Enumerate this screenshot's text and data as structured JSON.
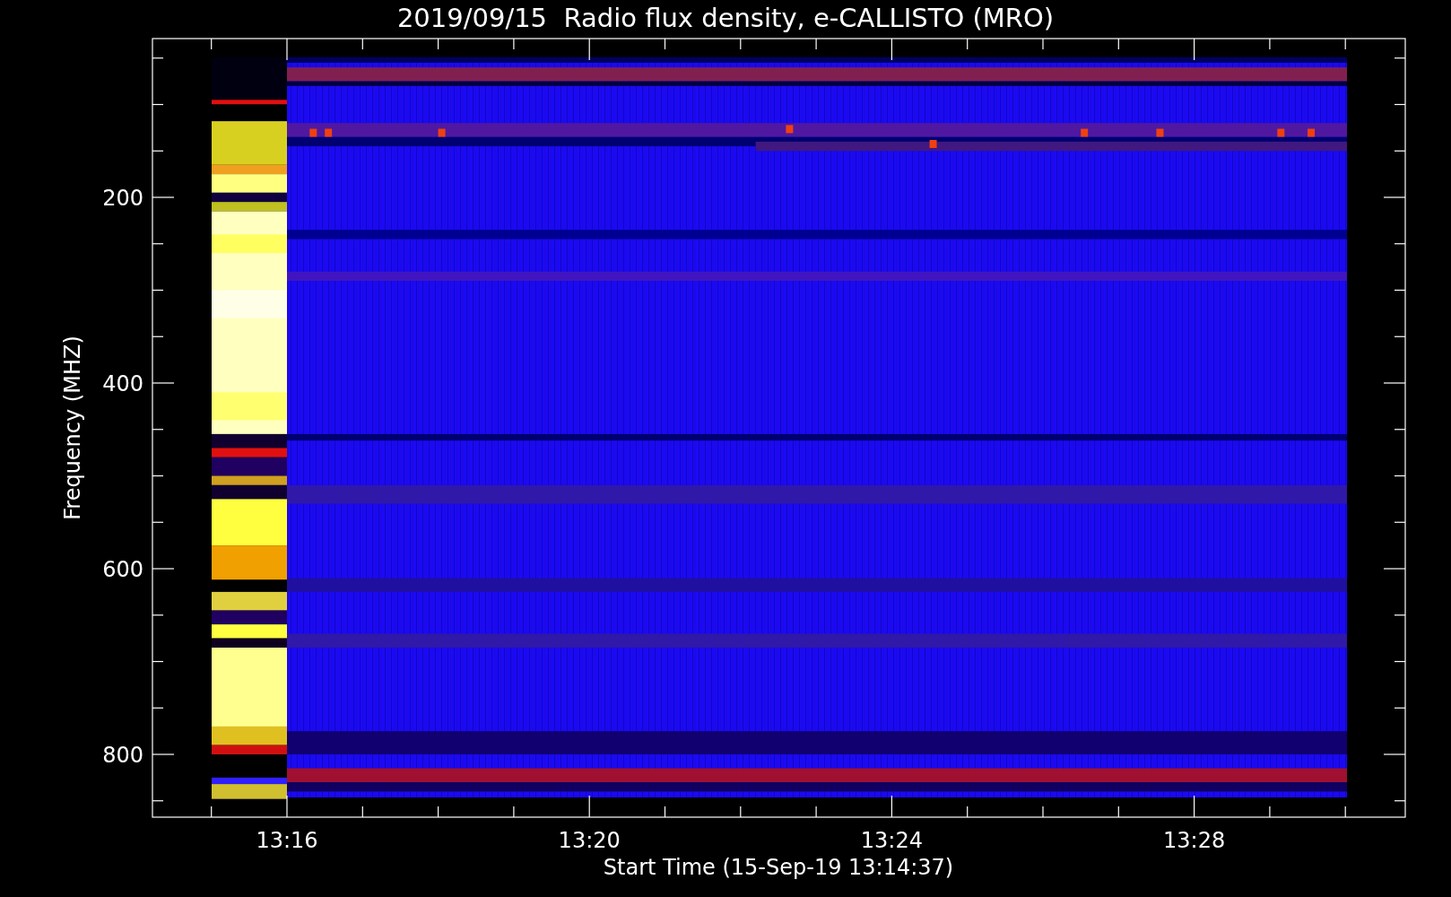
{
  "title": "2019/09/15  Radio flux density, e-CALLISTO (MRO)",
  "y_axis": {
    "label": "Frequency (MHZ)",
    "ticks": [
      "200",
      "400",
      "600",
      "800"
    ]
  },
  "x_axis": {
    "label": "Start Time (15-Sep-19 13:14:37)",
    "ticks": [
      "13:16",
      "13:20",
      "13:24",
      "13:28"
    ]
  }
}
